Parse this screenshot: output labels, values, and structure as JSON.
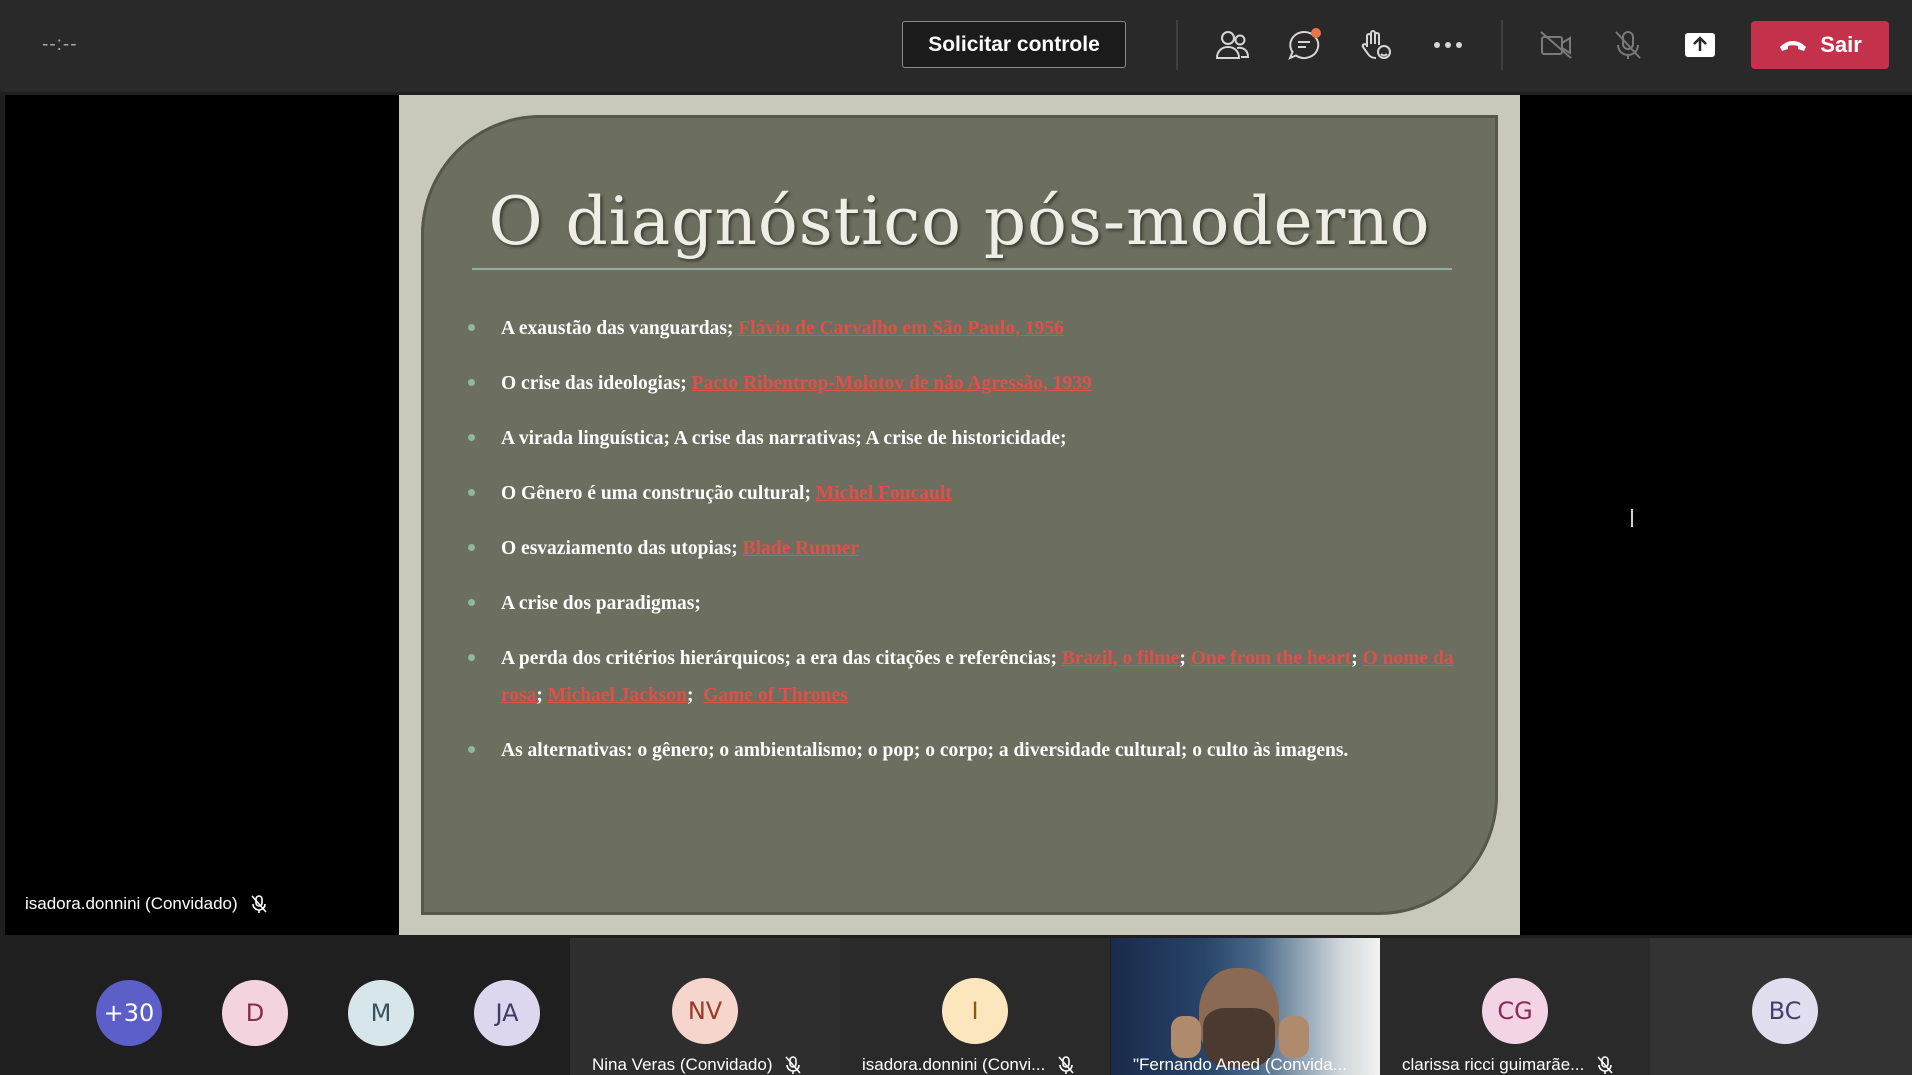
{
  "topbar": {
    "timer": "--:--",
    "request_control_label": "Solicitar controle",
    "leave_label": "Sair",
    "icons": [
      "people-icon",
      "chat-icon",
      "reactions-icon",
      "more-icon",
      "camera-off-icon",
      "mic-off-icon",
      "share-icon",
      "phone-icon"
    ]
  },
  "slide": {
    "title": "O diagnóstico pós-moderno",
    "bullets": [
      {
        "text": "A  exaustão das vanguardas; ",
        "link": "Flávio de Carvalho em São Paulo, 1956"
      },
      {
        "text": "O crise das ideologias; ",
        "link": "Pacto Ribentrop-Molotov de não Agressão, 1939"
      },
      {
        "text": "A virada linguística; A crise das narrativas; A crise de historicidade;"
      },
      {
        "text": "O Gênero é uma construção cultural; ",
        "link": "Michel Foucault"
      },
      {
        "text": "O esvaziamento das utopias; ",
        "link": "Blade Runner"
      },
      {
        "text": "A crise dos paradigmas;"
      },
      {
        "text": "A perda dos critérios hierárquicos; a era das citações e referências; ",
        "links": [
          "Brazil, o filme",
          "One from the heart",
          "O nome da rosa",
          "Michael Jackson",
          "Game of Thrones"
        ]
      },
      {
        "text": "As alternativas: o gênero; o ambientalismo; o pop; o corpo; a diversidade cultural; o culto às imagens."
      }
    ]
  },
  "stage": {
    "presenter_name": "isadora.donnini (Convidado)"
  },
  "participants": {
    "overflow": "+30",
    "avatars": [
      {
        "initials": "D",
        "bg": "#f3d4de",
        "fg": "#8a2a4a"
      },
      {
        "initials": "M",
        "bg": "#d7e6ea",
        "fg": "#37525c"
      },
      {
        "initials": "JA",
        "bg": "#dcd7ee",
        "fg": "#3f3a6a"
      }
    ],
    "tiles": [
      {
        "initials": "NV",
        "name": "Nina Veras (Convidado)",
        "bg": "#f6d6cc",
        "fg": "#9a3a28"
      },
      {
        "initials": "I",
        "name": "isadora.donnini (Convi...",
        "bg": "#fbe6bd",
        "fg": "#8a5a10"
      },
      {
        "name": "\"Fernando Amed (Convida..."
      },
      {
        "initials": "CG",
        "name": "clarissa ricci guimarãe...",
        "bg": "#f3d4e4",
        "fg": "#8a2a5a"
      },
      {
        "initials": "BC",
        "bg": "#e1def0",
        "fg": "#45406a"
      }
    ],
    "overflow_bg": "#5b5fc7"
  }
}
